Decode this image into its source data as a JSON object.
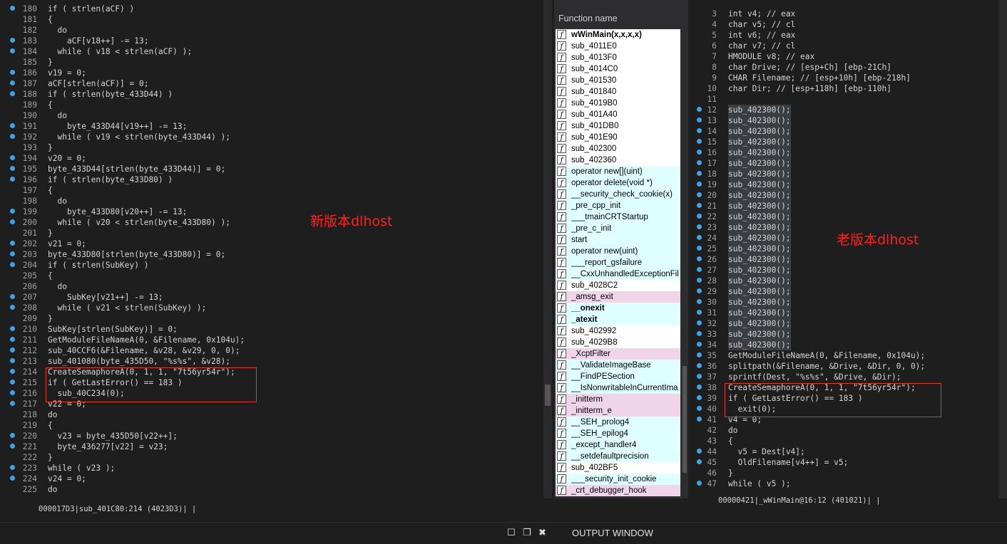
{
  "left_panel": {
    "annotation": "新版本dlhost",
    "status": "000017D3|sub_401C80:214 (4023D3)| |",
    "lines": [
      {
        "n": "180",
        "dot": true,
        "code": "if ( strlen(aCF) )"
      },
      {
        "n": "181",
        "dot": false,
        "code": "{"
      },
      {
        "n": "182",
        "dot": false,
        "code": "  do"
      },
      {
        "n": "183",
        "dot": true,
        "code": "    aCF[v18++] -= 13;"
      },
      {
        "n": "184",
        "dot": true,
        "code": "  while ( v18 < strlen(aCF) );"
      },
      {
        "n": "185",
        "dot": false,
        "code": "}"
      },
      {
        "n": "186",
        "dot": true,
        "code": "v19 = 0;"
      },
      {
        "n": "187",
        "dot": true,
        "code": "aCF[strlen(aCF)] = 0;"
      },
      {
        "n": "188",
        "dot": true,
        "code": "if ( strlen(byte_433D44) )"
      },
      {
        "n": "189",
        "dot": false,
        "code": "{"
      },
      {
        "n": "190",
        "dot": false,
        "code": "  do"
      },
      {
        "n": "191",
        "dot": true,
        "code": "    byte_433D44[v19++] -= 13;"
      },
      {
        "n": "192",
        "dot": true,
        "code": "  while ( v19 < strlen(byte_433D44) );"
      },
      {
        "n": "193",
        "dot": false,
        "code": "}"
      },
      {
        "n": "194",
        "dot": true,
        "code": "v20 = 0;"
      },
      {
        "n": "195",
        "dot": true,
        "code": "byte_433D44[strlen(byte_433D44)] = 0;"
      },
      {
        "n": "196",
        "dot": true,
        "code": "if ( strlen(byte_433D80) )"
      },
      {
        "n": "197",
        "dot": false,
        "code": "{"
      },
      {
        "n": "198",
        "dot": false,
        "code": "  do"
      },
      {
        "n": "199",
        "dot": true,
        "code": "    byte_433D80[v20++] -= 13;"
      },
      {
        "n": "200",
        "dot": true,
        "code": "  while ( v20 < strlen(byte_433D80) );"
      },
      {
        "n": "201",
        "dot": false,
        "code": "}"
      },
      {
        "n": "202",
        "dot": true,
        "code": "v21 = 0;"
      },
      {
        "n": "203",
        "dot": true,
        "code": "byte_433D80[strlen(byte_433D80)] = 0;"
      },
      {
        "n": "204",
        "dot": true,
        "code": "if ( strlen(SubKey) )"
      },
      {
        "n": "205",
        "dot": false,
        "code": "{"
      },
      {
        "n": "206",
        "dot": false,
        "code": "  do"
      },
      {
        "n": "207",
        "dot": true,
        "code": "    SubKey[v21++] -= 13;"
      },
      {
        "n": "208",
        "dot": true,
        "code": "  while ( v21 < strlen(SubKey) );"
      },
      {
        "n": "209",
        "dot": false,
        "code": "}"
      },
      {
        "n": "210",
        "dot": true,
        "code": "SubKey[strlen(SubKey)] = 0;"
      },
      {
        "n": "211",
        "dot": true,
        "code": "GetModuleFileNameA(0, &Filename, 0x104u);"
      },
      {
        "n": "212",
        "dot": true,
        "code": "sub_40CCF6(&Filename, &v28, &v29, 0, 0);"
      },
      {
        "n": "213",
        "dot": true,
        "code": "sub_401080(byte_435D50, \"%s%s\", &v28);"
      },
      {
        "n": "214",
        "dot": true,
        "code": "CreateSemaphoreA(0, 1, 1, \"7t56yr54r\");"
      },
      {
        "n": "215",
        "dot": true,
        "code": "if ( GetLastError() == 183 )"
      },
      {
        "n": "216",
        "dot": true,
        "code": "  sub_40C234(0);"
      },
      {
        "n": "217",
        "dot": true,
        "code": "v22 = 0;"
      },
      {
        "n": "218",
        "dot": false,
        "code": "do"
      },
      {
        "n": "219",
        "dot": false,
        "code": "{"
      },
      {
        "n": "220",
        "dot": true,
        "code": "  v23 = byte_435D50[v22++];"
      },
      {
        "n": "221",
        "dot": true,
        "code": "  byte_436277[v22] = v23;"
      },
      {
        "n": "222",
        "dot": false,
        "code": "}"
      },
      {
        "n": "223",
        "dot": true,
        "code": "while ( v23 );"
      },
      {
        "n": "224",
        "dot": true,
        "code": "v24 = 0;"
      },
      {
        "n": "225",
        "dot": false,
        "code": "do"
      }
    ]
  },
  "function_panel": {
    "header": "Function name",
    "icon_glyph": "f",
    "items": [
      {
        "name": "wWinMain(x,x,x,x)",
        "color": "white",
        "bold": true
      },
      {
        "name": "sub_4011E0",
        "color": "white",
        "bold": false
      },
      {
        "name": "sub_4013F0",
        "color": "white",
        "bold": false
      },
      {
        "name": "sub_4014C0",
        "color": "white",
        "bold": false
      },
      {
        "name": "sub_401530",
        "color": "white",
        "bold": false
      },
      {
        "name": "sub_401840",
        "color": "white",
        "bold": false
      },
      {
        "name": "sub_4019B0",
        "color": "white",
        "bold": false
      },
      {
        "name": "sub_401A40",
        "color": "white",
        "bold": false
      },
      {
        "name": "sub_401DB0",
        "color": "white",
        "bold": false
      },
      {
        "name": "sub_401E90",
        "color": "white",
        "bold": false
      },
      {
        "name": "sub_402300",
        "color": "white",
        "bold": false
      },
      {
        "name": "sub_402360",
        "color": "white",
        "bold": false
      },
      {
        "name": "operator new[](uint)",
        "color": "cyan",
        "bold": false
      },
      {
        "name": "operator delete(void *)",
        "color": "cyan",
        "bold": false
      },
      {
        "name": "__security_check_cookie(x)",
        "color": "cyan",
        "bold": false
      },
      {
        "name": "_pre_cpp_init",
        "color": "cyan",
        "bold": false
      },
      {
        "name": "___tmainCRTStartup",
        "color": "cyan",
        "bold": false
      },
      {
        "name": "_pre_c_init",
        "color": "cyan",
        "bold": false
      },
      {
        "name": "start",
        "color": "cyan",
        "bold": false
      },
      {
        "name": "operator new(uint)",
        "color": "cyan",
        "bold": false
      },
      {
        "name": "___report_gsfailure",
        "color": "cyan",
        "bold": false
      },
      {
        "name": "__CxxUnhandledExceptionFil",
        "color": "cyan",
        "bold": false
      },
      {
        "name": "sub_4028C2",
        "color": "white",
        "bold": false
      },
      {
        "name": "_amsg_exit",
        "color": "pink",
        "bold": false
      },
      {
        "name": "__onexit",
        "color": "cyan",
        "bold": true
      },
      {
        "name": "_atexit",
        "color": "cyan",
        "bold": true
      },
      {
        "name": "sub_402992",
        "color": "white",
        "bold": false
      },
      {
        "name": "sub_4029B8",
        "color": "white",
        "bold": false
      },
      {
        "name": "_XcptFilter",
        "color": "pink",
        "bold": false
      },
      {
        "name": "__ValidateImageBase",
        "color": "cyan",
        "bold": false
      },
      {
        "name": "__FindPESection",
        "color": "cyan",
        "bold": false
      },
      {
        "name": "__IsNonwritableInCurrentIma",
        "color": "cyan",
        "bold": false
      },
      {
        "name": "_initterm",
        "color": "pink",
        "bold": false
      },
      {
        "name": "_initterm_e",
        "color": "pink",
        "bold": false
      },
      {
        "name": "__SEH_prolog4",
        "color": "cyan",
        "bold": false
      },
      {
        "name": "__SEH_epilog4",
        "color": "cyan",
        "bold": false
      },
      {
        "name": "_except_handler4",
        "color": "cyan",
        "bold": false
      },
      {
        "name": "__setdefaultprecision",
        "color": "cyan",
        "bold": false
      },
      {
        "name": "sub_402BF5",
        "color": "white",
        "bold": false
      },
      {
        "name": "___security_init_cookie",
        "color": "cyan",
        "bold": false
      },
      {
        "name": "_crt_debugger_hook",
        "color": "pink",
        "bold": false
      }
    ]
  },
  "right_panel": {
    "annotation": "老版本dlhost",
    "status": "00000421|_wWinMain@16:12 (401021)| |",
    "lines": [
      {
        "n": "3",
        "dot": false,
        "code": "int v4; // eax"
      },
      {
        "n": "4",
        "dot": false,
        "code": "char v5; // cl"
      },
      {
        "n": "5",
        "dot": false,
        "code": "int v6; // eax"
      },
      {
        "n": "6",
        "dot": false,
        "code": "char v7; // cl"
      },
      {
        "n": "7",
        "dot": false,
        "code": "HMODULE v8; // eax"
      },
      {
        "n": "8",
        "dot": false,
        "code": "char Drive; // [esp+Ch] [ebp-21Ch]"
      },
      {
        "n": "9",
        "dot": false,
        "code": "CHAR Filename; // [esp+10h] [ebp-218h]"
      },
      {
        "n": "10",
        "dot": false,
        "code": "char Dir; // [esp+118h] [ebp-110h]"
      },
      {
        "n": "11",
        "dot": false,
        "code": ""
      },
      {
        "n": "12",
        "dot": true,
        "code": "sub_402300();"
      },
      {
        "n": "13",
        "dot": true,
        "code": "sub_402300();"
      },
      {
        "n": "14",
        "dot": true,
        "code": "sub_402300();"
      },
      {
        "n": "15",
        "dot": true,
        "code": "sub_402300();"
      },
      {
        "n": "16",
        "dot": true,
        "code": "sub_402300();"
      },
      {
        "n": "17",
        "dot": true,
        "code": "sub_402300();"
      },
      {
        "n": "18",
        "dot": true,
        "code": "sub_402300();"
      },
      {
        "n": "19",
        "dot": true,
        "code": "sub_402300();"
      },
      {
        "n": "20",
        "dot": true,
        "code": "sub_402300();"
      },
      {
        "n": "21",
        "dot": true,
        "code": "sub_402300();"
      },
      {
        "n": "22",
        "dot": true,
        "code": "sub_402300();"
      },
      {
        "n": "23",
        "dot": true,
        "code": "sub_402300();"
      },
      {
        "n": "24",
        "dot": true,
        "code": "sub_402300();"
      },
      {
        "n": "25",
        "dot": true,
        "code": "sub_402300();"
      },
      {
        "n": "26",
        "dot": true,
        "code": "sub_402300();"
      },
      {
        "n": "27",
        "dot": true,
        "code": "sub_402300();"
      },
      {
        "n": "28",
        "dot": true,
        "code": "sub_402300();"
      },
      {
        "n": "29",
        "dot": true,
        "code": "sub_402300();"
      },
      {
        "n": "30",
        "dot": true,
        "code": "sub_402300();"
      },
      {
        "n": "31",
        "dot": true,
        "code": "sub_402300();"
      },
      {
        "n": "32",
        "dot": true,
        "code": "sub_402300();"
      },
      {
        "n": "33",
        "dot": true,
        "code": "sub_402300();"
      },
      {
        "n": "34",
        "dot": true,
        "code": "sub_402300();"
      },
      {
        "n": "35",
        "dot": true,
        "code": "GetModuleFileNameA(0, &Filename, 0x104u);"
      },
      {
        "n": "36",
        "dot": true,
        "code": "splitpath(&Filename, &Drive, &Dir, 0, 0);"
      },
      {
        "n": "37",
        "dot": true,
        "code": "sprintf(Dest, \"%s%s\", &Drive, &Dir);"
      },
      {
        "n": "38",
        "dot": true,
        "code": "CreateSemaphoreA(0, 1, 1, \"7t56yr54r\");"
      },
      {
        "n": "39",
        "dot": true,
        "code": "if ( GetLastError() == 183 )"
      },
      {
        "n": "40",
        "dot": true,
        "code": "  exit(0);"
      },
      {
        "n": "41",
        "dot": true,
        "code": "v4 = 0;"
      },
      {
        "n": "42",
        "dot": false,
        "code": "do"
      },
      {
        "n": "43",
        "dot": false,
        "code": "{"
      },
      {
        "n": "44",
        "dot": true,
        "code": "  v5 = Dest[v4];"
      },
      {
        "n": "45",
        "dot": true,
        "code": "  OldFilename[v4++] = v5;"
      },
      {
        "n": "46",
        "dot": false,
        "code": "}"
      },
      {
        "n": "47",
        "dot": true,
        "code": "while ( v5 );"
      }
    ]
  },
  "bottom": {
    "output_label": "OUTPUT WINDOW",
    "restore_glyph": "☐",
    "float_glyph": "❐",
    "close_glyph": "✖"
  },
  "colors": {
    "accent_red": "#e23b2e",
    "breakpoint_dot": "#3fa3ea"
  }
}
